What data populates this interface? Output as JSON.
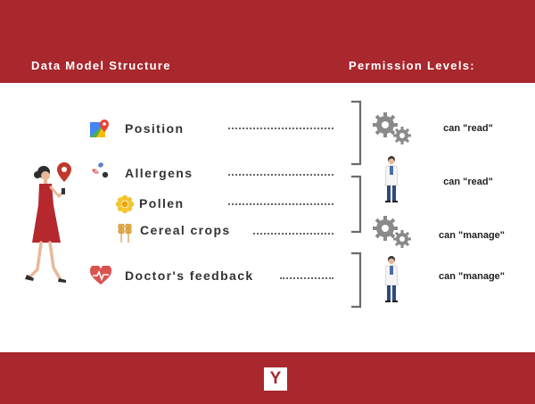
{
  "headers": {
    "left": "Data Model Structure",
    "right": "Permission Levels:"
  },
  "items": [
    {
      "label": "Position",
      "icon": "map-icon"
    },
    {
      "label": "Allergens",
      "icon": "allergens-icon"
    },
    {
      "label": "Pollen",
      "icon": "pollen-flower-icon"
    },
    {
      "label": "Cereal crops",
      "icon": "wheat-icon"
    },
    {
      "label": "Doctor's feedback",
      "icon": "heart-pulse-icon"
    }
  ],
  "permissions": [
    {
      "label": "can \"read\"",
      "actor": "gears-icon"
    },
    {
      "label": "can \"read\"",
      "actor": "doctor-icon"
    },
    {
      "label": "can \"manage\"",
      "actor": "gears-icon"
    },
    {
      "label": "can \"manage\"",
      "actor": "doctor-icon"
    }
  ],
  "logo": {
    "letter": "Y"
  },
  "colors": {
    "brand": "#a8282d",
    "text": "#333333",
    "icon_gray": "#8a8a8a"
  }
}
